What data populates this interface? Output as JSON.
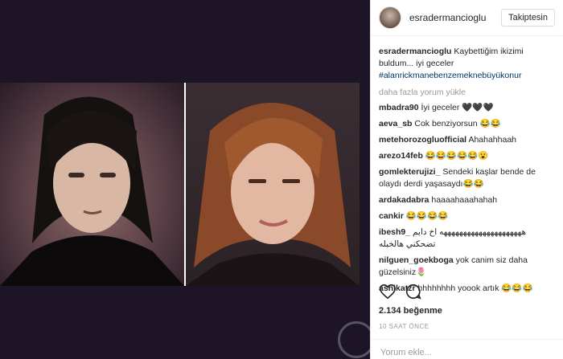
{
  "post": {
    "username": "esradermancioglu",
    "follow_label": "Takiptesin",
    "caption_user": "esradermancioglu",
    "caption_text": "Kaybettiğim ikizimi buldum... iyi geceler",
    "caption_hashtag": "#alanrickmanebenzemeknebüyükonur",
    "load_more": "daha fazla yorum yükle",
    "likes": "2.134 beğenme",
    "timestamp": "10 SAAT ÖNCE",
    "comment_placeholder": "Yorum ekle..."
  },
  "comments": [
    {
      "user": "mbadra90",
      "text": "İyi geceler 🖤🖤🖤"
    },
    {
      "user": "aeva_sb",
      "text": "Cok benziyorsun 😂😂"
    },
    {
      "user": "metehorozogluofficial",
      "text": "Ahahahhaah"
    },
    {
      "user": "arezo14feb",
      "text": "😂😂😂😂😂😮"
    },
    {
      "user": "gomlekterujizi_",
      "text": "Sendeki kaşlar bende de olaydı derdi yaşasaydı😂😂"
    },
    {
      "user": "ardakadabra",
      "text": "haaaahaaahahah"
    },
    {
      "user": "cankir",
      "text": "😂😂😂😂"
    },
    {
      "user": "ibesh9_",
      "text": "هههههههههههههههههههههه اخ دايم تضحكني هالخبله"
    },
    {
      "user": "nilguen_goekboga",
      "text": "yok canim siz daha güzelsiniz🌷"
    },
    {
      "user": "ashikatzr",
      "text": "hhhhhhhh yoook artık 😂😂😂"
    }
  ],
  "icons": {
    "like": "heart-icon",
    "comment": "comment-icon"
  },
  "colors": {
    "media_bg": "#1d1426",
    "hashtag": "#003569",
    "muted": "#999999"
  }
}
